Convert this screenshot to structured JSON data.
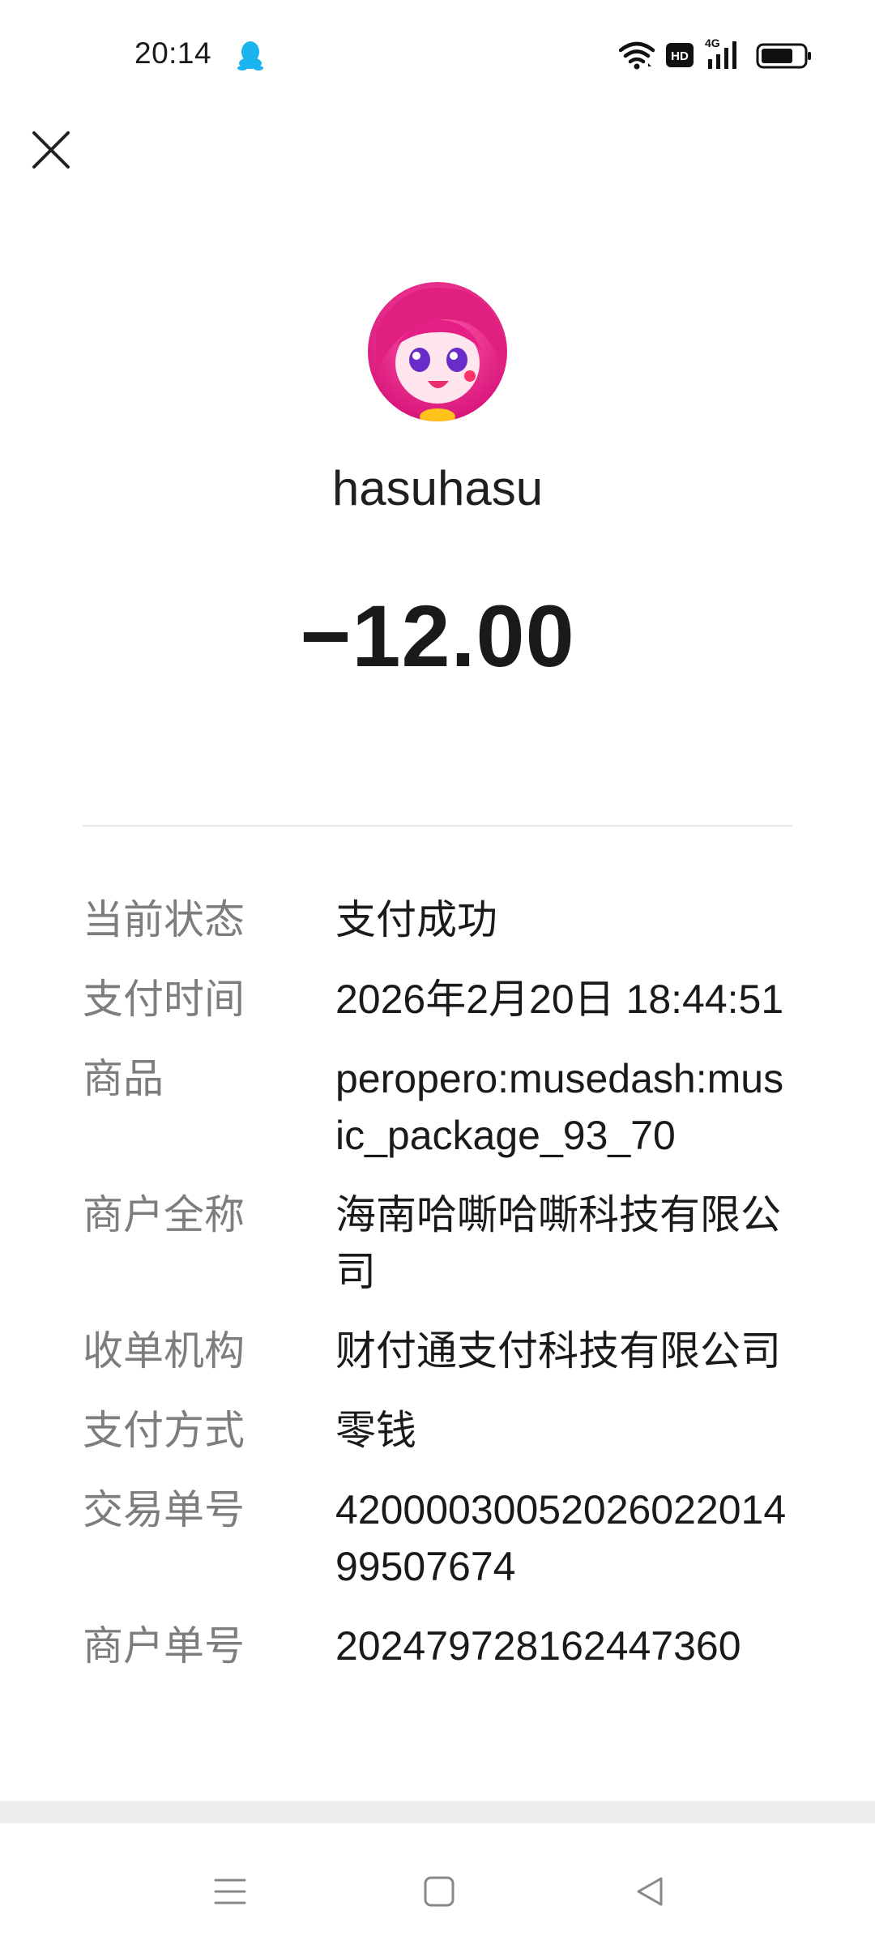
{
  "status_bar": {
    "time": "20:14",
    "icons": [
      "qq-icon",
      "wifi-icon",
      "hd-icon",
      "signal-4g-icon",
      "battery-icon"
    ],
    "network_label": "4G",
    "hd_label": "HD"
  },
  "header": {
    "close_icon": "close-icon"
  },
  "payee": {
    "name": "hasuhasu",
    "avatar": "anime-girl-avatar"
  },
  "amount": "−12.00",
  "details": [
    {
      "label": "当前状态",
      "value": "支付成功"
    },
    {
      "label": "支付时间",
      "value": "2026年2月20日 18:44:51"
    },
    {
      "label": "商品",
      "value": "peropero:musedash:music_package_93_70"
    },
    {
      "label": "商户全称",
      "value": "海南哈嘶哈嘶科技有限公司"
    },
    {
      "label": "收单机构",
      "value": "财付通支付科技有限公司"
    },
    {
      "label": "支付方式",
      "value": "零钱"
    },
    {
      "label": "交易单号",
      "value": "4200003005202602201499507674"
    },
    {
      "label": "商户单号",
      "value": "202479728162447360"
    }
  ],
  "nav_bar": {
    "icons": [
      "menu-icon",
      "home-square-icon",
      "back-triangle-icon"
    ]
  },
  "colors": {
    "label": "#7d7d7d",
    "value": "#1a1a1a",
    "qq_blue": "#1ab4f0",
    "avatar_pink": "#e8308a"
  }
}
